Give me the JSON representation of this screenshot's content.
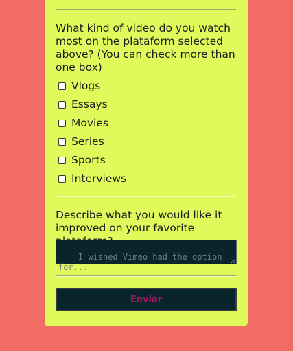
{
  "form": {
    "video_question": "What kind of video do you watch most on the plataform selected above? (You can check more than one box)",
    "video_options": [
      "Vlogs",
      "Essays",
      "Movies",
      "Series",
      "Sports",
      "Interviews"
    ],
    "improve_question": "Describe what you would like it improved on your favorite plataform?",
    "improve_placeholder": "I wished Vimeo had the option for...",
    "submit_label": "Enviar"
  },
  "colors": {
    "page_background": "#f26c66",
    "card_background": "#e0fa5c",
    "input_background": "#0a242c",
    "submit_text": "#a1185f"
  }
}
